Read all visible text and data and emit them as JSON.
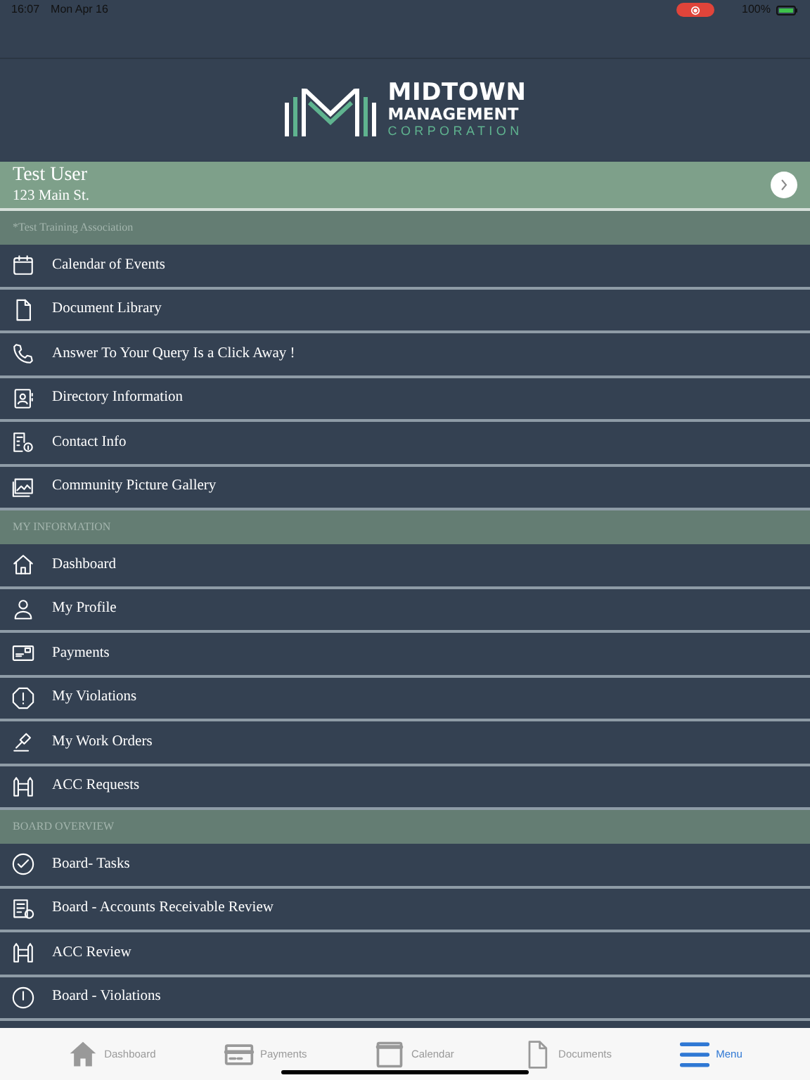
{
  "status_bar": {
    "time": "16:07",
    "date": "Mon Apr 16",
    "recording": true,
    "battery": "100%"
  },
  "logo": {
    "line_1": "MIDTOWN",
    "line_2": "MANAGEMENT",
    "line_3": "CORPORATION"
  },
  "user": {
    "name": "Test User",
    "address": "123 Main St."
  },
  "sections": [
    {
      "title": "*Test Training Association",
      "items": [
        "Calendar of Events",
        "Document Library",
        "Answer To Your Query Is a Click Away !",
        "Directory Information",
        "Contact Info",
        "Community Picture Gallery"
      ]
    },
    {
      "title": "MY INFORMATION",
      "items": [
        "Dashboard",
        "My Profile",
        "Payments",
        "My Violations",
        "My Work Orders",
        "ACC Requests"
      ]
    },
    {
      "title": "BOARD OVERVIEW",
      "items": [
        "Board- Tasks",
        "Board - Accounts Receivable Review",
        "ACC Review",
        "Board - Violations"
      ]
    }
  ],
  "tab_bar": [
    {
      "label": "Dashboard",
      "selected": false
    },
    {
      "label": "Payments",
      "selected": false
    },
    {
      "label": "Calendar",
      "selected": false
    },
    {
      "label": "Documents",
      "selected": false
    },
    {
      "label": "Menu",
      "selected": true
    }
  ]
}
